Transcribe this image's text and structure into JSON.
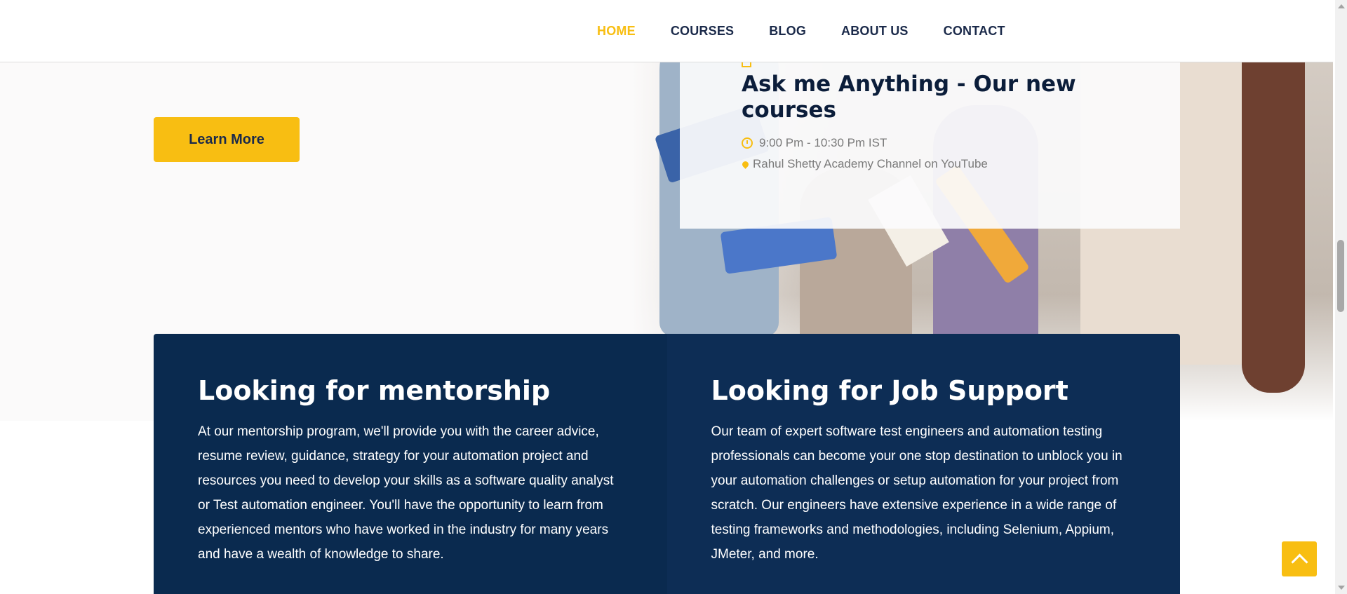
{
  "nav": {
    "items": [
      {
        "label": "HOME",
        "active": true
      },
      {
        "label": "COURSES",
        "active": false
      },
      {
        "label": "BLOG",
        "active": false
      },
      {
        "label": "ABOUT US",
        "active": false
      },
      {
        "label": "CONTACT",
        "active": false
      }
    ]
  },
  "hero": {
    "learn_more_label": "Learn More"
  },
  "event": {
    "title": "Ask me Anything - Our new courses",
    "time": "9:00 Pm - 10:30 Pm IST",
    "location": "Rahul Shetty Academy Channel on YouTube"
  },
  "support": {
    "mentorship": {
      "title": "Looking for mentorship",
      "text": "At our mentorship program, we'll provide you with the career advice, resume review, guidance, strategy for your automation project and resources you need to develop your skills as a software quality analyst or Test automation engineer. You'll have the opportunity to learn from experienced mentors who have worked in the industry for many years and have a wealth of knowledge to share."
    },
    "job_support": {
      "title": "Looking for Job Support",
      "text": "Our team of expert software test engineers and automation testing professionals can become your one stop destination to unblock you in your automation challenges or setup automation for your project from scratch. Our engineers have extensive experience in a wide range of testing frameworks and methodologies, including Selenium, Appium, JMeter, and more."
    }
  },
  "colors": {
    "accent": "#f8be12",
    "navy": "#0a2a4f",
    "nav_text": "#1b2a4a"
  },
  "icons": {
    "calendar": "calendar-icon",
    "clock": "clock-icon",
    "location": "map-pin-icon",
    "back_to_top": "chevron-up-icon"
  }
}
